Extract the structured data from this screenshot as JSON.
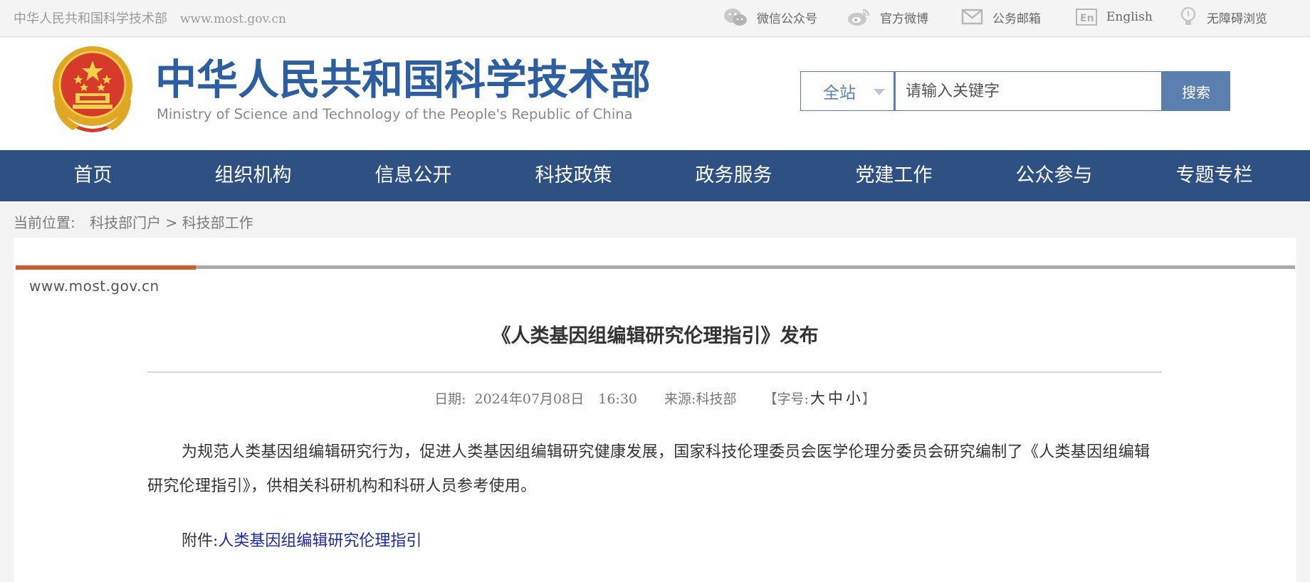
{
  "topbar": {
    "site_name": "中华人民共和国科学技术部",
    "site_url": "www.most.gov.cn",
    "links": [
      {
        "label": "微信公众号",
        "icon": "wechat-icon"
      },
      {
        "label": "官方微博",
        "icon": "weibo-icon"
      },
      {
        "label": "公务邮箱",
        "icon": "mail-icon"
      },
      {
        "label": "English",
        "icon": "english-icon"
      },
      {
        "label": "无障碍浏览",
        "icon": "accessibility-icon"
      }
    ]
  },
  "header": {
    "logo_cn": "中华人民共和国科学技术部",
    "logo_en": "Ministry of Science and Technology of the People's Republic of China",
    "search": {
      "scope": "全站",
      "placeholder": "请输入关键字",
      "button": "搜索"
    }
  },
  "nav": {
    "items": [
      "首页",
      "组织机构",
      "信息公开",
      "科技政策",
      "政务服务",
      "党建工作",
      "公众参与",
      "专题专栏"
    ]
  },
  "breadcrumb": {
    "label": "当前位置:",
    "items": [
      "科技部门户",
      "科技部工作"
    ],
    "separator": ">"
  },
  "article": {
    "watermark": "www.most.gov.cn",
    "title": "《人类基因组编辑研究伦理指引》发布",
    "date_label": "日期:",
    "date": "2024年07月08日",
    "time": "16:30",
    "source_label": "来源:",
    "source": "科技部",
    "font_label_open": "【字号:",
    "font_large": "大",
    "font_medium": "中",
    "font_small": "小",
    "font_label_close": "】",
    "body": "为规范人类基因组编辑研究行为，促进人类基因组编辑研究健康发展，国家科技伦理委员会医学伦理分委员会研究编制了《人类基因组编辑研究伦理指引》，供相关科研机构和科研人员参考使用。",
    "attachment_label": "附件:",
    "attachment_link": "人类基因组编辑研究伦理指引"
  },
  "colors": {
    "brand_blue": "#2f5083",
    "search_blue": "#5b7fae",
    "accent_orange": "#cf5b2c",
    "link_blue": "#1b2aa6"
  }
}
